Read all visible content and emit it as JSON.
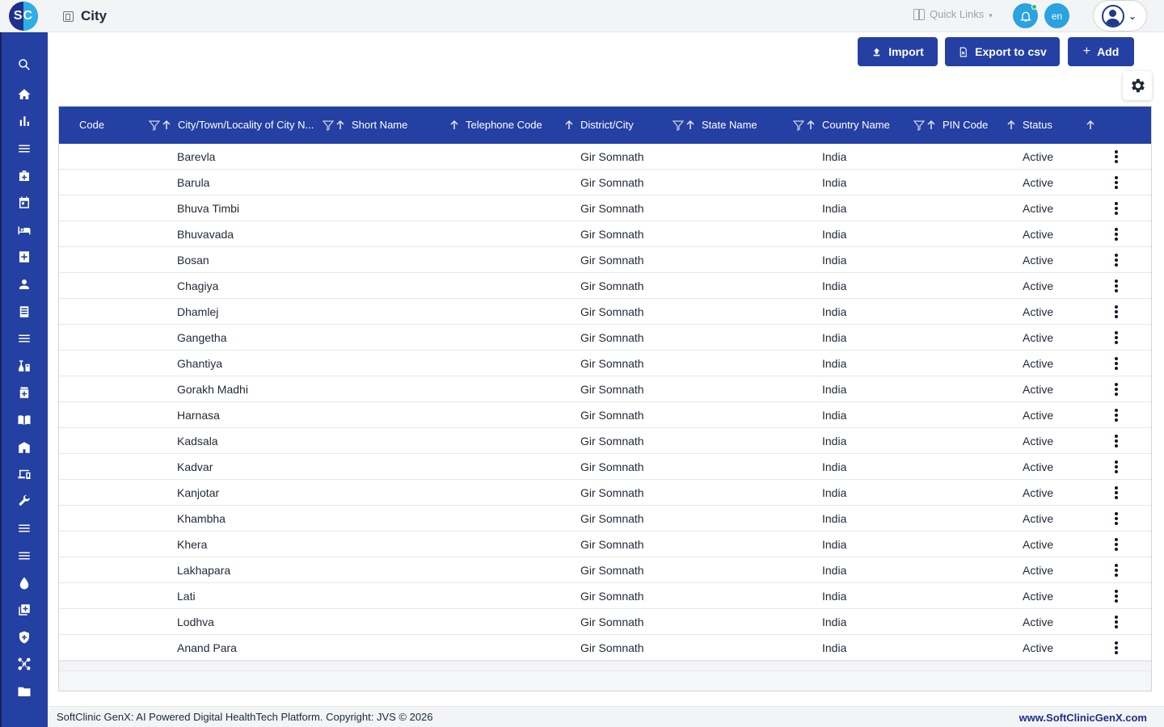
{
  "app": {
    "logo_text": "SC",
    "page_title": "City"
  },
  "header": {
    "quick_links_label": "Quick Links",
    "language": "en"
  },
  "sidebar": {
    "items": [
      {
        "name": "search"
      },
      {
        "name": "home"
      },
      {
        "name": "dashboard"
      },
      {
        "name": "menu"
      },
      {
        "name": "medical-bag"
      },
      {
        "name": "calendar"
      },
      {
        "name": "bed"
      },
      {
        "name": "medical-plus"
      },
      {
        "name": "person"
      },
      {
        "name": "receipt"
      },
      {
        "name": "list"
      },
      {
        "name": "lab"
      },
      {
        "name": "pharmacy"
      },
      {
        "name": "book"
      },
      {
        "name": "store"
      },
      {
        "name": "devices"
      },
      {
        "name": "wrench"
      },
      {
        "name": "list-2"
      },
      {
        "name": "list-3"
      },
      {
        "name": "blood-drop"
      },
      {
        "name": "add-box"
      },
      {
        "name": "shield"
      },
      {
        "name": "hub"
      },
      {
        "name": "folder"
      }
    ]
  },
  "toolbar": {
    "import_label": "Import",
    "export_label": "Export to csv",
    "add_label": "Add"
  },
  "table": {
    "columns": [
      "Code",
      "City/Town/Locality of City N...",
      "Short Name",
      "Telephone Code",
      "District/City",
      "State Name",
      "Country Name",
      "PIN Code",
      "Status"
    ],
    "rows": [
      {
        "code": "",
        "city": "Barevla",
        "short": "",
        "tel": "",
        "district": "Gir Somnath",
        "state": "",
        "country": "India",
        "pin": "",
        "status": "Active"
      },
      {
        "code": "",
        "city": "Barula",
        "short": "",
        "tel": "",
        "district": "Gir Somnath",
        "state": "",
        "country": "India",
        "pin": "",
        "status": "Active"
      },
      {
        "code": "",
        "city": "Bhuva Timbi",
        "short": "",
        "tel": "",
        "district": "Gir Somnath",
        "state": "",
        "country": "India",
        "pin": "",
        "status": "Active"
      },
      {
        "code": "",
        "city": "Bhuvavada",
        "short": "",
        "tel": "",
        "district": "Gir Somnath",
        "state": "",
        "country": "India",
        "pin": "",
        "status": "Active"
      },
      {
        "code": "",
        "city": "Bosan",
        "short": "",
        "tel": "",
        "district": "Gir Somnath",
        "state": "",
        "country": "India",
        "pin": "",
        "status": "Active"
      },
      {
        "code": "",
        "city": "Chagiya",
        "short": "",
        "tel": "",
        "district": "Gir Somnath",
        "state": "",
        "country": "India",
        "pin": "",
        "status": "Active"
      },
      {
        "code": "",
        "city": "Dhamlej",
        "short": "",
        "tel": "",
        "district": "Gir Somnath",
        "state": "",
        "country": "India",
        "pin": "",
        "status": "Active"
      },
      {
        "code": "",
        "city": "Gangetha",
        "short": "",
        "tel": "",
        "district": "Gir Somnath",
        "state": "",
        "country": "India",
        "pin": "",
        "status": "Active"
      },
      {
        "code": "",
        "city": "Ghantiya",
        "short": "",
        "tel": "",
        "district": "Gir Somnath",
        "state": "",
        "country": "India",
        "pin": "",
        "status": "Active"
      },
      {
        "code": "",
        "city": "Gorakh Madhi",
        "short": "",
        "tel": "",
        "district": "Gir Somnath",
        "state": "",
        "country": "India",
        "pin": "",
        "status": "Active"
      },
      {
        "code": "",
        "city": "Harnasa",
        "short": "",
        "tel": "",
        "district": "Gir Somnath",
        "state": "",
        "country": "India",
        "pin": "",
        "status": "Active"
      },
      {
        "code": "",
        "city": "Kadsala",
        "short": "",
        "tel": "",
        "district": "Gir Somnath",
        "state": "",
        "country": "India",
        "pin": "",
        "status": "Active"
      },
      {
        "code": "",
        "city": "Kadvar",
        "short": "",
        "tel": "",
        "district": "Gir Somnath",
        "state": "",
        "country": "India",
        "pin": "",
        "status": "Active"
      },
      {
        "code": "",
        "city": "Kanjotar",
        "short": "",
        "tel": "",
        "district": "Gir Somnath",
        "state": "",
        "country": "India",
        "pin": "",
        "status": "Active"
      },
      {
        "code": "",
        "city": "Khambha",
        "short": "",
        "tel": "",
        "district": "Gir Somnath",
        "state": "",
        "country": "India",
        "pin": "",
        "status": "Active"
      },
      {
        "code": "",
        "city": "Khera",
        "short": "",
        "tel": "",
        "district": "Gir Somnath",
        "state": "",
        "country": "India",
        "pin": "",
        "status": "Active"
      },
      {
        "code": "",
        "city": "Lakhapara",
        "short": "",
        "tel": "",
        "district": "Gir Somnath",
        "state": "",
        "country": "India",
        "pin": "",
        "status": "Active"
      },
      {
        "code": "",
        "city": "Lati",
        "short": "",
        "tel": "",
        "district": "Gir Somnath",
        "state": "",
        "country": "India",
        "pin": "",
        "status": "Active"
      },
      {
        "code": "",
        "city": "Lodhva",
        "short": "",
        "tel": "",
        "district": "Gir Somnath",
        "state": "",
        "country": "India",
        "pin": "",
        "status": "Active"
      },
      {
        "code": "",
        "city": "Anand Para",
        "short": "",
        "tel": "",
        "district": "Gir Somnath",
        "state": "",
        "country": "India",
        "pin": "",
        "status": "Active"
      }
    ]
  },
  "footer": {
    "copyright": "SoftClinic GenX: AI Powered Digital HealthTech Platform. Copyright: JVS © 2026",
    "website": "www.SoftClinicGenX.com"
  },
  "colors": {
    "primary": "#2440a3",
    "accent": "#2aa3df",
    "logo_dark": "#1e2f8c"
  }
}
